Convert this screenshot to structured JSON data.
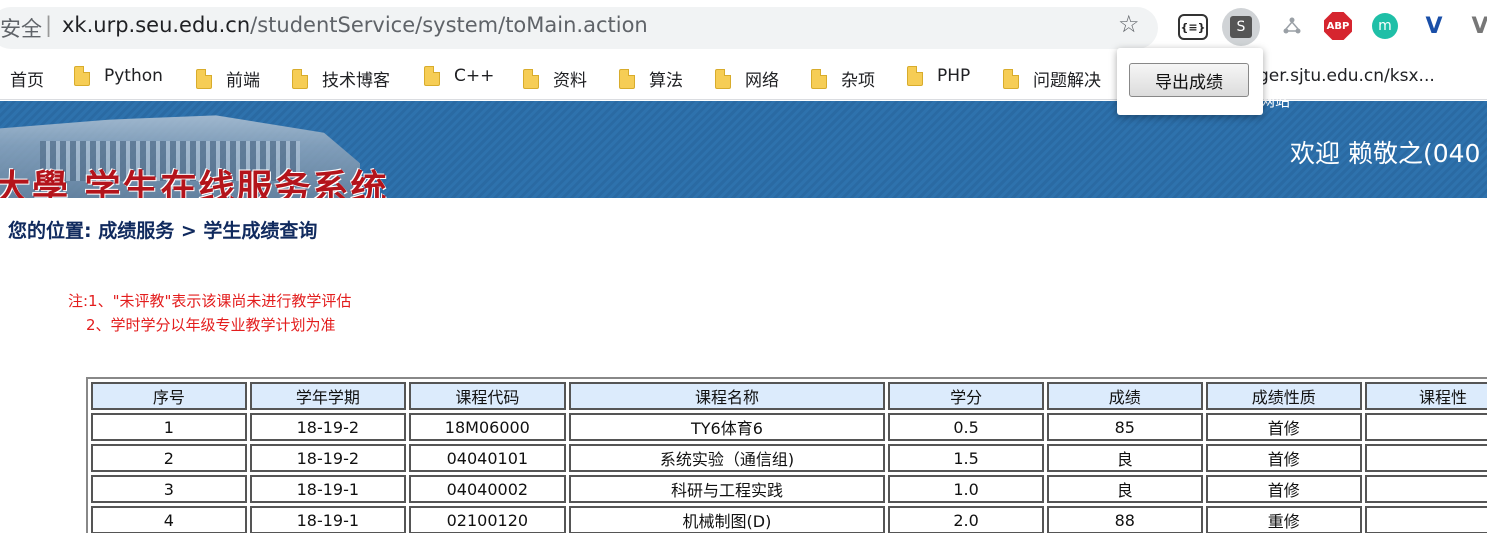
{
  "browser": {
    "security_label": "安全",
    "separator": "|",
    "url_host": "xk.urp.seu.edu.cn",
    "url_path": "/studentService/system/toMain.action",
    "star_icon": "star-icon",
    "extensions": [
      "json-viewer-icon",
      "s-extension-icon",
      "network-icon",
      "adblock-plus-icon",
      "m-extension-icon",
      "v-extension-icon",
      "v-extension-grey-icon"
    ],
    "ext_labels": {
      "json": "{≡}",
      "s": "S",
      "abp": "ABP",
      "m": "m",
      "v": "V",
      "v2": "V"
    }
  },
  "bookmarks": {
    "home": "首页",
    "items": [
      "Python",
      "前端",
      "技术博客",
      "C++",
      "资料",
      "算法",
      "网络",
      "杂项",
      "PHP",
      "问题解决"
    ],
    "tail": "ger.sjtu.edu.cn/ksx...",
    "tail2": "网站"
  },
  "popup": {
    "button_label": "导出成绩"
  },
  "banner": {
    "title": "大學 学生在线服务系统",
    "welcome": "欢迎 赖敬之(040"
  },
  "breadcrumb": "您的位置: 成绩服务 > 学生成绩查询",
  "notes": {
    "line1": "注:1、\"未评教\"表示该课尚未进行教学评估",
    "line2": "2、学时学分以年级专业教学计划为准"
  },
  "table": {
    "headers": [
      "序号",
      "学年学期",
      "课程代码",
      "课程名称",
      "学分",
      "成绩",
      "成绩性质",
      "课程性"
    ],
    "rows": [
      [
        "1",
        "18-19-2",
        "18M06000",
        "TY6体育6",
        "0.5",
        "85",
        "首修",
        ""
      ],
      [
        "2",
        "18-19-2",
        "04040101",
        "系统实验（通信组)",
        "1.5",
        "良",
        "首修",
        ""
      ],
      [
        "3",
        "18-19-1",
        "04040002",
        "科研与工程实践",
        "1.0",
        "良",
        "首修",
        ""
      ],
      [
        "4",
        "18-19-1",
        "02100120",
        "机械制图(D)",
        "2.0",
        "88",
        "重修",
        ""
      ]
    ]
  }
}
